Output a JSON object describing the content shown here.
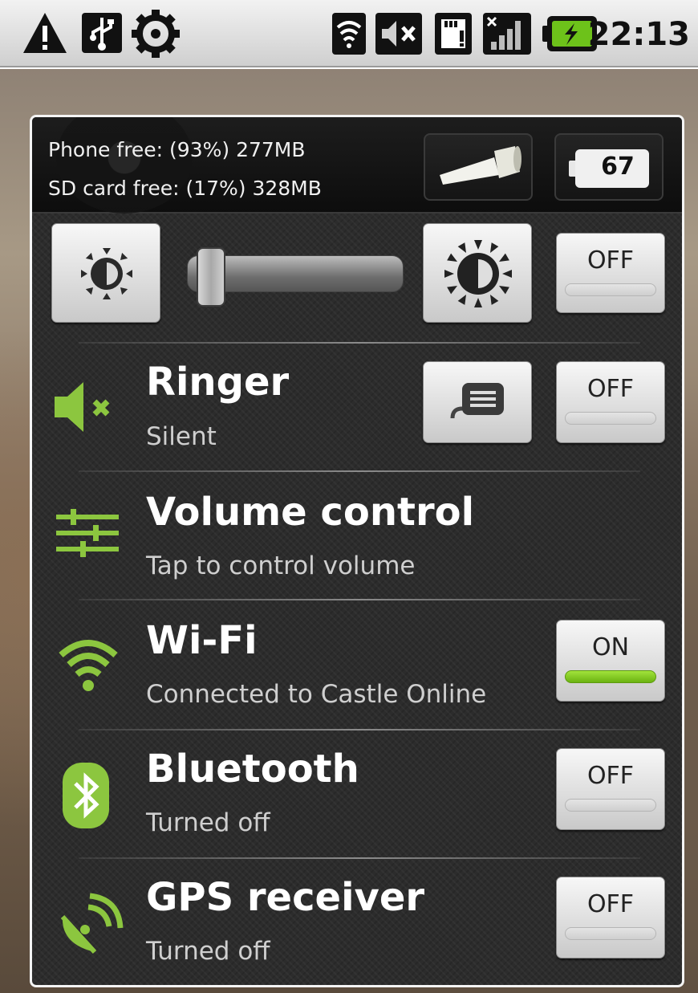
{
  "status_bar": {
    "icons": [
      "warning-icon",
      "usb-icon",
      "settings-icon",
      "wifi-signal-icon",
      "muted-icon",
      "sd-card-icon",
      "signal-no-sim-icon",
      "battery-charging-icon"
    ],
    "time": "22:13"
  },
  "widget": {
    "storage": {
      "phone_free": "Phone free: (93%) 277MB",
      "sd_free": "SD card free: (17%) 328MB"
    },
    "flashlight_icon": "flashlight-icon",
    "battery_level": "67",
    "brightness": {
      "level_fraction": 0.05,
      "auto_label": "OFF"
    },
    "rows": [
      {
        "id": "ringer",
        "icon": "speaker-muted-icon",
        "title": "Ringer",
        "subtitle": "Silent",
        "extra_button_icon": "message-icon",
        "toggle_label": "OFF",
        "toggle_on": false
      },
      {
        "id": "volume",
        "icon": "sliders-icon",
        "title": "Volume control",
        "subtitle": "Tap to control volume"
      },
      {
        "id": "wifi",
        "icon": "wifi-icon",
        "title": "Wi-Fi",
        "subtitle": "Connected to Castle Online",
        "toggle_label": "ON",
        "toggle_on": true
      },
      {
        "id": "bluetooth",
        "icon": "bluetooth-icon",
        "title": "Bluetooth",
        "subtitle": "Turned off",
        "toggle_label": "OFF",
        "toggle_on": false
      },
      {
        "id": "gps",
        "icon": "satellite-dish-icon",
        "title": "GPS receiver",
        "subtitle": "Turned off",
        "toggle_label": "OFF",
        "toggle_on": false
      }
    ]
  },
  "colors": {
    "accent_green": "#8cc63f",
    "panel_bg": "#2c2c2c",
    "toggle_on": "#7cc41d"
  }
}
